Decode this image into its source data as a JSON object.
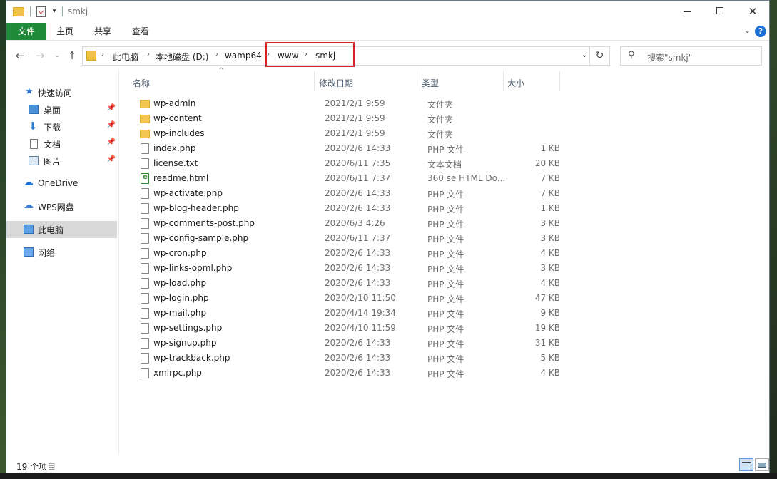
{
  "window": {
    "title": "smkj",
    "controls": {
      "minimize": "—",
      "maximize": "□",
      "close": "✕"
    }
  },
  "ribbon": {
    "tabs": [
      {
        "label": "文件"
      },
      {
        "label": "主页"
      },
      {
        "label": "共享"
      },
      {
        "label": "查看"
      }
    ],
    "help": "?"
  },
  "address": {
    "crumbs": [
      "此电脑",
      "本地磁盘 (D:)",
      "wamp64",
      "www",
      "smkj"
    ]
  },
  "search": {
    "placeholder": "搜索\"smkj\""
  },
  "nav": {
    "quick_access": "快速访问",
    "items": [
      {
        "label": "桌面",
        "pinned": true
      },
      {
        "label": "下载",
        "pinned": true
      },
      {
        "label": "文档",
        "pinned": true
      },
      {
        "label": "图片",
        "pinned": true
      }
    ],
    "onedrive": "OneDrive",
    "wps": "WPS网盘",
    "this_pc": "此电脑",
    "network": "网络"
  },
  "columns": {
    "name": "名称",
    "date": "修改日期",
    "type": "类型",
    "size": "大小"
  },
  "files": [
    {
      "name": "wp-admin",
      "date": "2021/2/1 9:59",
      "type": "文件夹",
      "size": "",
      "kind": "folder"
    },
    {
      "name": "wp-content",
      "date": "2021/2/1 9:59",
      "type": "文件夹",
      "size": "",
      "kind": "folder"
    },
    {
      "name": "wp-includes",
      "date": "2021/2/1 9:59",
      "type": "文件夹",
      "size": "",
      "kind": "folder"
    },
    {
      "name": "index.php",
      "date": "2020/2/6 14:33",
      "type": "PHP 文件",
      "size": "1 KB",
      "kind": "doc"
    },
    {
      "name": "license.txt",
      "date": "2020/6/11 7:35",
      "type": "文本文档",
      "size": "20 KB",
      "kind": "doc"
    },
    {
      "name": "readme.html",
      "date": "2020/6/11 7:37",
      "type": "360 se HTML Do...",
      "size": "7 KB",
      "kind": "html"
    },
    {
      "name": "wp-activate.php",
      "date": "2020/2/6 14:33",
      "type": "PHP 文件",
      "size": "7 KB",
      "kind": "doc"
    },
    {
      "name": "wp-blog-header.php",
      "date": "2020/2/6 14:33",
      "type": "PHP 文件",
      "size": "1 KB",
      "kind": "doc"
    },
    {
      "name": "wp-comments-post.php",
      "date": "2020/6/3 4:26",
      "type": "PHP 文件",
      "size": "3 KB",
      "kind": "doc"
    },
    {
      "name": "wp-config-sample.php",
      "date": "2020/6/11 7:37",
      "type": "PHP 文件",
      "size": "3 KB",
      "kind": "doc"
    },
    {
      "name": "wp-cron.php",
      "date": "2020/2/6 14:33",
      "type": "PHP 文件",
      "size": "4 KB",
      "kind": "doc"
    },
    {
      "name": "wp-links-opml.php",
      "date": "2020/2/6 14:33",
      "type": "PHP 文件",
      "size": "3 KB",
      "kind": "doc"
    },
    {
      "name": "wp-load.php",
      "date": "2020/2/6 14:33",
      "type": "PHP 文件",
      "size": "4 KB",
      "kind": "doc"
    },
    {
      "name": "wp-login.php",
      "date": "2020/2/10 11:50",
      "type": "PHP 文件",
      "size": "47 KB",
      "kind": "doc"
    },
    {
      "name": "wp-mail.php",
      "date": "2020/4/14 19:34",
      "type": "PHP 文件",
      "size": "9 KB",
      "kind": "doc"
    },
    {
      "name": "wp-settings.php",
      "date": "2020/4/10 11:59",
      "type": "PHP 文件",
      "size": "19 KB",
      "kind": "doc"
    },
    {
      "name": "wp-signup.php",
      "date": "2020/2/6 14:33",
      "type": "PHP 文件",
      "size": "31 KB",
      "kind": "doc"
    },
    {
      "name": "wp-trackback.php",
      "date": "2020/2/6 14:33",
      "type": "PHP 文件",
      "size": "5 KB",
      "kind": "doc"
    },
    {
      "name": "xmlrpc.php",
      "date": "2020/2/6 14:33",
      "type": "PHP 文件",
      "size": "4 KB",
      "kind": "doc"
    }
  ],
  "status": {
    "count": "19 个项目"
  },
  "colors": {
    "file_tab": "#1e8a3a",
    "highlight_box": "#d62424",
    "selected_nav": "#d9d9d9"
  }
}
